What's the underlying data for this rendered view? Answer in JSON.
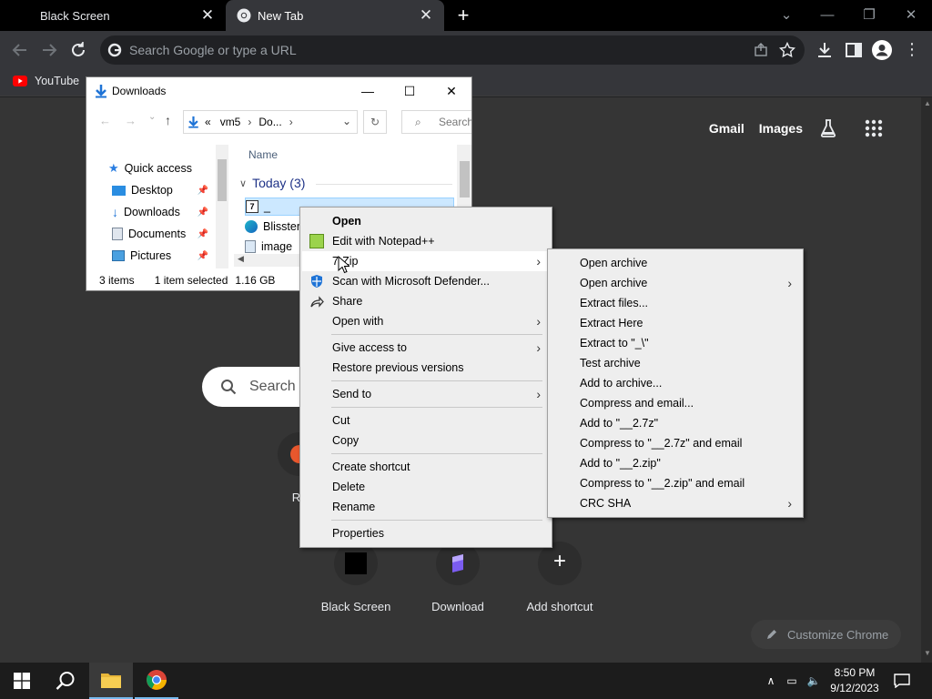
{
  "browser": {
    "tabs": [
      {
        "title": "Black Screen",
        "active": false
      },
      {
        "title": "New Tab",
        "active": true
      }
    ],
    "new_tab_symbol": "+",
    "omnibox": {
      "placeholder": "Search Google or type a URL"
    },
    "bookmarks": [
      {
        "label": "YouTube",
        "icon": "youtube-icon"
      }
    ]
  },
  "ntp": {
    "links": {
      "gmail": "Gmail",
      "images": "Images"
    },
    "search_placeholder": "Search G",
    "shortcuts": [
      {
        "label": "Re"
      },
      {
        "label": "Black Screen"
      },
      {
        "label": "Download"
      },
      {
        "label": "Add shortcut"
      }
    ],
    "customize_label": "Customize Chrome"
  },
  "explorer": {
    "title": "Downloads",
    "breadcrumb": {
      "prefix": "«",
      "segments": [
        "vm5",
        "Do..."
      ]
    },
    "search_placeholder": "Search",
    "nav_items": [
      {
        "label": "Quick access",
        "icon": "star-icon"
      },
      {
        "label": "Desktop",
        "icon": "desktop-icon"
      },
      {
        "label": "Downloads",
        "icon": "download-icon"
      },
      {
        "label": "Documents",
        "icon": "documents-icon"
      },
      {
        "label": "Pictures",
        "icon": "pictures-icon"
      }
    ],
    "column_name": "Name",
    "group_label": "Today (3)",
    "files": [
      {
        "name": "_",
        "icon": "7zip-archive-icon",
        "selected": true
      },
      {
        "name": "Blisster",
        "icon": "edge-icon"
      },
      {
        "name": "image",
        "icon": "image-icon"
      }
    ],
    "status": {
      "items": "3 items",
      "selected": "1 item selected",
      "size": "1.16 GB"
    }
  },
  "context_menu": {
    "items": [
      {
        "label": "Open",
        "bold": true
      },
      {
        "label": "Edit with Notepad++",
        "icon": "notepadpp-icon"
      },
      {
        "label": "7-Zip",
        "submenu": true,
        "highlighted": true
      },
      {
        "label": "Scan with Microsoft Defender...",
        "icon": "defender-icon"
      },
      {
        "label": "Share",
        "icon": "share-icon"
      },
      {
        "label": "Open with",
        "submenu": true
      },
      {
        "label": "Give access to",
        "submenu": true
      },
      {
        "label": "Restore previous versions"
      },
      {
        "label": "Send to",
        "submenu": true
      },
      {
        "label": "Cut"
      },
      {
        "label": "Copy"
      },
      {
        "label": "Create shortcut"
      },
      {
        "label": "Delete"
      },
      {
        "label": "Rename"
      },
      {
        "label": "Properties"
      }
    ]
  },
  "zip_menu": {
    "items": [
      {
        "label": "Open archive"
      },
      {
        "label": "Open archive",
        "submenu": true
      },
      {
        "label": "Extract files..."
      },
      {
        "label": "Extract Here"
      },
      {
        "label": "Extract to \"_\\\""
      },
      {
        "label": "Test archive"
      },
      {
        "label": "Add to archive..."
      },
      {
        "label": "Compress and email..."
      },
      {
        "label": "Add to \"__2.7z\""
      },
      {
        "label": "Compress to \"__2.7z\" and email"
      },
      {
        "label": "Add to \"__2.zip\""
      },
      {
        "label": "Compress to \"__2.zip\" and email"
      },
      {
        "label": "CRC SHA",
        "submenu": true
      }
    ]
  },
  "taskbar": {
    "time": "8:50 PM",
    "date": "9/12/2023"
  },
  "colors": {
    "chrome_frame": "#000000",
    "chrome_toolbar": "#35363a",
    "ntp_background": "#353535",
    "menu_background": "#eeeeee",
    "menu_highlight": "#ffffff",
    "taskbar": "#1c1c1c"
  }
}
